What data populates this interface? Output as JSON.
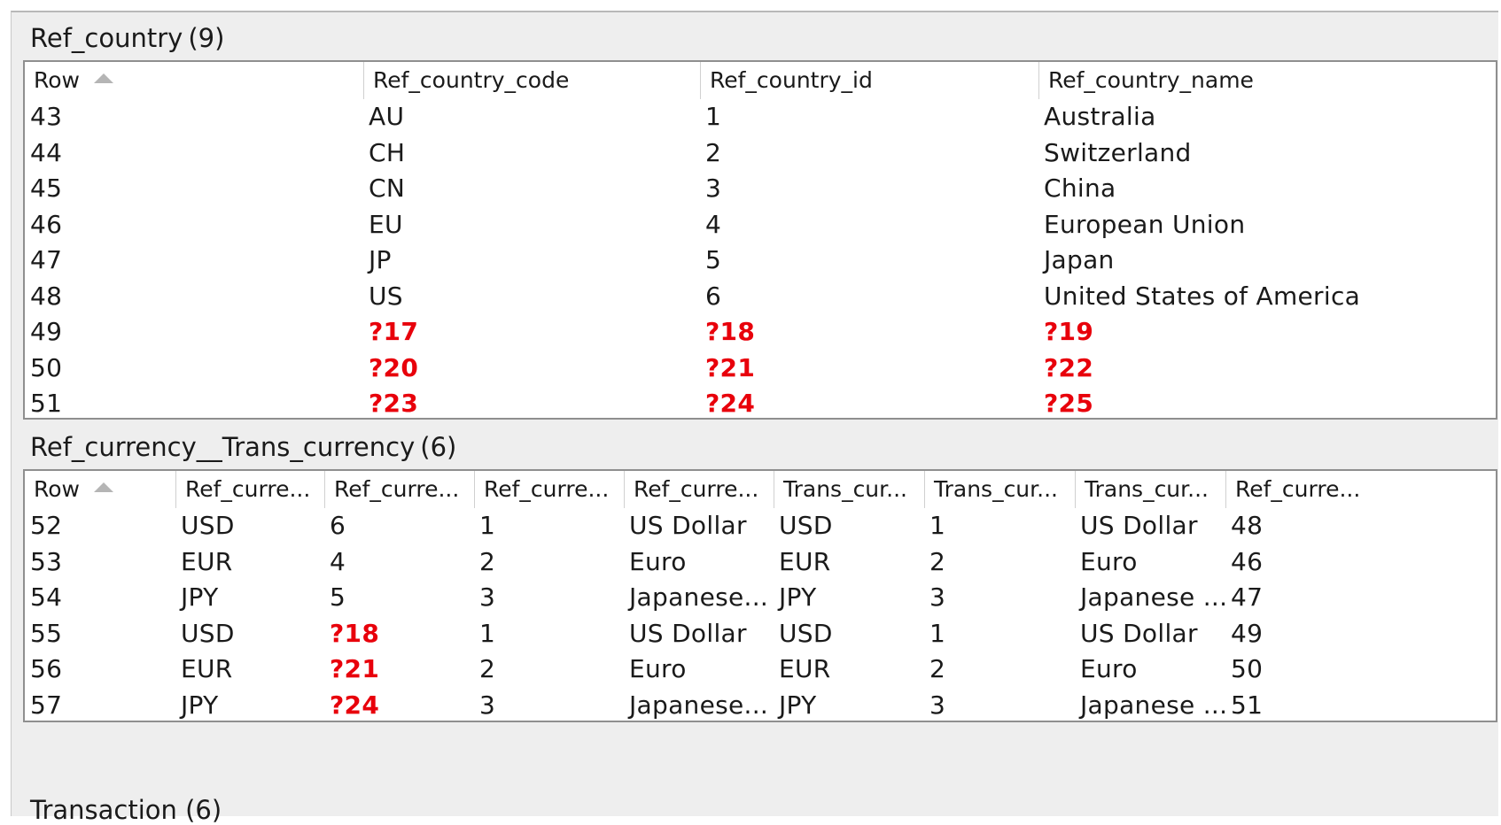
{
  "tables": [
    {
      "name": "Ref_country",
      "count": "(9)",
      "columns": [
        "Row",
        "Ref_country_code",
        "Ref_country_id",
        "Ref_country_name"
      ],
      "rows": [
        [
          "43",
          "AU",
          "1",
          "Australia"
        ],
        [
          "44",
          "CH",
          "2",
          "Switzerland"
        ],
        [
          "45",
          "CN",
          "3",
          "China"
        ],
        [
          "46",
          "EU",
          "4",
          "European Union"
        ],
        [
          "47",
          "JP",
          "5",
          "Japan"
        ],
        [
          "48",
          "US",
          "6",
          "United States of America"
        ],
        [
          "49",
          "?17",
          "?18",
          "?19"
        ],
        [
          "50",
          "?20",
          "?21",
          "?22"
        ],
        [
          "51",
          "?23",
          "?24",
          "?25"
        ]
      ]
    },
    {
      "name": "Ref_currency__Trans_currency",
      "count": "(6)",
      "columns": [
        "Row",
        "Ref_curre...",
        "Ref_curre...",
        "Ref_curre...",
        "Ref_curre...",
        "Trans_cur...",
        "Trans_cur...",
        "Trans_cur...",
        "Ref_curre..."
      ],
      "rows": [
        [
          "52",
          "USD",
          "6",
          "1",
          "US Dollar",
          "USD",
          "1",
          "US Dollar",
          "48"
        ],
        [
          "53",
          "EUR",
          "4",
          "2",
          "Euro",
          "EUR",
          "2",
          "Euro",
          "46"
        ],
        [
          "54",
          "JPY",
          "5",
          "3",
          "Japanese...",
          "JPY",
          "3",
          "Japanese ...",
          "47"
        ],
        [
          "55",
          "USD",
          "?18",
          "1",
          "US Dollar",
          "USD",
          "1",
          "US Dollar",
          "49"
        ],
        [
          "56",
          "EUR",
          "?21",
          "2",
          "Euro",
          "EUR",
          "2",
          "Euro",
          "50"
        ],
        [
          "57",
          "JPY",
          "?24",
          "3",
          "Japanese...",
          "JPY",
          "3",
          "Japanese ...",
          "51"
        ]
      ]
    }
  ],
  "next_section_title": "Transaction (6)",
  "colors": {
    "missing_value": "#e8000b",
    "header_separator": "#d0d0d0",
    "panel_background": "#eeeeee"
  },
  "icons": {
    "sort_indicator": "sort-ascending-icon"
  }
}
